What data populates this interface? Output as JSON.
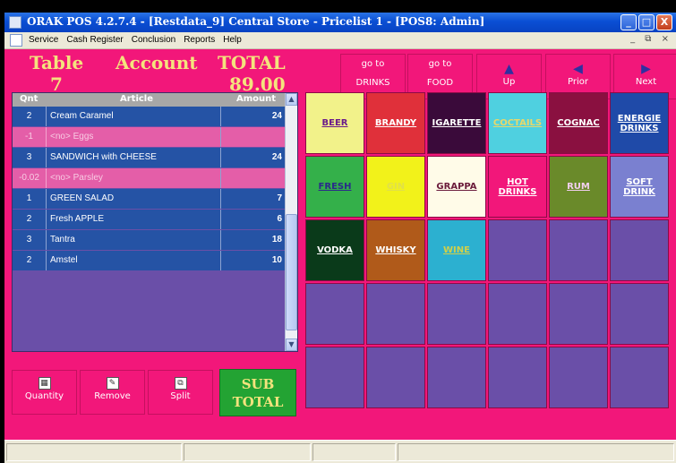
{
  "window": {
    "title": "ORAK POS 4.2.7.4 - [Restdata_9] Central Store - Pricelist 1 - [POS8: Admin]",
    "minimize": "_",
    "maximize": "□",
    "close": "X"
  },
  "menu": {
    "items": [
      "Service",
      "Cash Register",
      "Conclusion",
      "Reports",
      "Help"
    ],
    "mdi_controls": "_ ⧉ ×"
  },
  "header": {
    "table_label": "Table",
    "table_number": "7",
    "account_label": "Account",
    "total_label": "TOTAL",
    "total_value": "89.00"
  },
  "nav": {
    "drinks_line1": "go to",
    "drinks_line2": "DRINKS",
    "food_line1": "go to",
    "food_line2": "FOOD",
    "up": "Up",
    "prior": "Prior",
    "next": "Next"
  },
  "order": {
    "columns": [
      "Qnt",
      "Article",
      "Amount"
    ],
    "rows": [
      {
        "qty": "2",
        "article": "Cream Caramel",
        "amount": "24",
        "kind": "item"
      },
      {
        "qty": "-1",
        "article": "<no> Eggs",
        "amount": "",
        "kind": "modifier"
      },
      {
        "qty": "3",
        "article": "SANDWICH with CHEESE",
        "amount": "24",
        "kind": "item"
      },
      {
        "qty": "-0.02",
        "article": "<no> Parsley",
        "amount": "",
        "kind": "modifier"
      },
      {
        "qty": "1",
        "article": "GREEN SALAD",
        "amount": "7",
        "kind": "item"
      },
      {
        "qty": "2",
        "article": "Fresh APPLE",
        "amount": "6",
        "kind": "item"
      },
      {
        "qty": "3",
        "article": "Tantra",
        "amount": "18",
        "kind": "item"
      },
      {
        "qty": "2",
        "article": "Amstel",
        "amount": "10",
        "kind": "item"
      }
    ]
  },
  "actions": {
    "quantity": "Quantity",
    "remove": "Remove",
    "split": "Split",
    "subtotal_line1": "SUB",
    "subtotal_line2": "TOTAL"
  },
  "categories": [
    {
      "label": "BEER",
      "bg": "#f2f28a",
      "fg": "#6a1a8a"
    },
    {
      "label": "BRANDY",
      "bg": "#e0303a",
      "fg": "#ffffff"
    },
    {
      "label": "IGARETTE",
      "bg": "#3a0a3a",
      "fg": "#ffffff"
    },
    {
      "label": "COCTAILS",
      "bg": "#4fd0e0",
      "fg": "#e8d86a"
    },
    {
      "label": "COGNAC",
      "bg": "#8a1040",
      "fg": "#ffffff"
    },
    {
      "label": "ENERGIE DRINKS",
      "bg": "#1f4aa8",
      "fg": "#ffffff"
    },
    {
      "label": "FRESH",
      "bg": "#34b04a",
      "fg": "#2a2a8a"
    },
    {
      "label": "GIN",
      "bg": "#f2f21a",
      "fg": "#e0e04a"
    },
    {
      "label": "GRAPPA",
      "bg": "#fffbe8",
      "fg": "#6a1a3a"
    },
    {
      "label": "HOT DRINKS",
      "bg": "#f2177a",
      "fg": "#ffffff"
    },
    {
      "label": "RUM",
      "bg": "#6a8a2a",
      "fg": "#f2d0f0"
    },
    {
      "label": "SOFT DRINK",
      "bg": "#7a80d0",
      "fg": "#ffffff"
    },
    {
      "label": "VODKA",
      "bg": "#0a3a1a",
      "fg": "#ffffff"
    },
    {
      "label": "WHISKY",
      "bg": "#b05a1a",
      "fg": "#ffffff"
    },
    {
      "label": "WINE",
      "bg": "#2cb0d0",
      "fg": "#d0d04a"
    }
  ],
  "colors": {
    "background": "#f2177a",
    "header_text": "#f4e37d",
    "empty_cell": "#6a4fa8"
  }
}
